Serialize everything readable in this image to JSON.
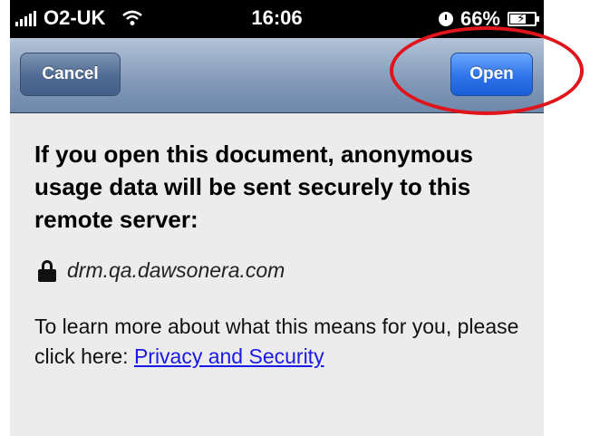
{
  "status_bar": {
    "carrier": "O2-UK",
    "time": "16:06",
    "battery": "66%",
    "battery_level": 0.66
  },
  "nav_bar": {
    "cancel_label": "Cancel",
    "open_label": "Open"
  },
  "content": {
    "heading": "If you open this document, anonymous usage data will be sent securely to this remote server:",
    "server": "drm.qa.dawsonera.com",
    "info_text": "To learn more about what this means for you, please click here: ",
    "link_text": "Privacy and Security"
  },
  "colors": {
    "highlight": "#e0141b",
    "link": "#1a1ae6",
    "open_button": "#2f73e8"
  }
}
